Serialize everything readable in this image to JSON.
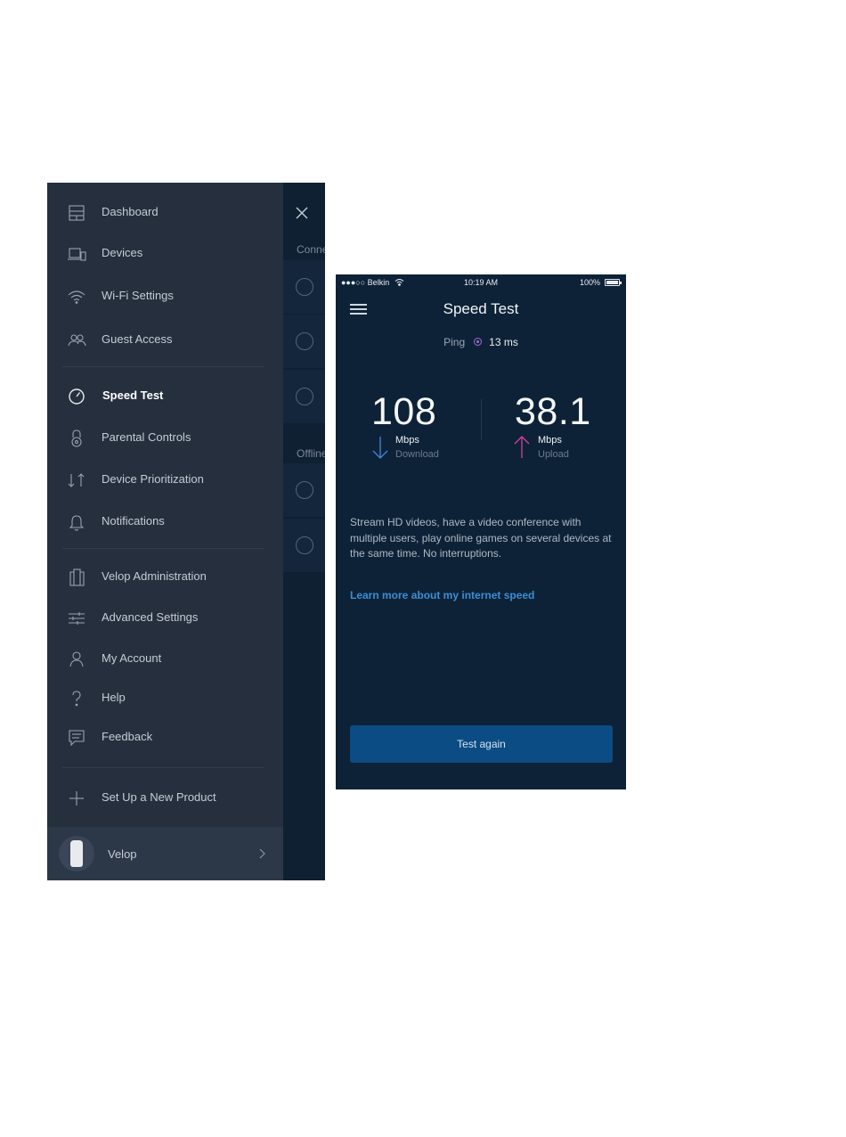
{
  "menu": {
    "items": [
      {
        "label": "Dashboard",
        "icon": "dashboard-icon"
      },
      {
        "label": "Devices",
        "icon": "devices-icon"
      },
      {
        "label": "Wi-Fi Settings",
        "icon": "wifi-icon"
      },
      {
        "label": "Guest Access",
        "icon": "guest-access-icon"
      },
      {
        "label": "Speed Test",
        "icon": "speedometer-icon",
        "active": true
      },
      {
        "label": "Parental Controls",
        "icon": "padlock-icon"
      },
      {
        "label": "Device Prioritization",
        "icon": "priority-arrows-icon"
      },
      {
        "label": "Notifications",
        "icon": "bell-icon"
      },
      {
        "label": "Velop Administration",
        "icon": "velop-admin-icon"
      },
      {
        "label": "Advanced Settings",
        "icon": "sliders-icon"
      },
      {
        "label": "My Account",
        "icon": "person-icon"
      },
      {
        "label": "Help",
        "icon": "question-icon"
      },
      {
        "label": "Feedback",
        "icon": "chat-icon"
      },
      {
        "label": "Set Up a New Product",
        "icon": "plus-icon"
      }
    ],
    "footer": {
      "label": "Velop",
      "icon": "velop-node-icon"
    }
  },
  "background_panel": {
    "section_connected": "Conne",
    "section_offline": "Offline"
  },
  "phone": {
    "status": {
      "carrier": "●●●○○ Belkin",
      "time": "10:19 AM",
      "battery": "100%"
    },
    "title": "Speed Test",
    "ping": {
      "label": "Ping",
      "value": "13 ms"
    },
    "download": {
      "value": "108",
      "unit": "Mbps",
      "label": "Download",
      "color": "#3d8be0"
    },
    "upload": {
      "value": "38.1",
      "unit": "Mbps",
      "label": "Upload",
      "color": "#d43fa0"
    },
    "description": "Stream HD videos, have a video conference with multiple users, play online games on several devices at the same time. No interruptions.",
    "learn_more": "Learn more about my internet speed",
    "test_again": "Test again"
  }
}
